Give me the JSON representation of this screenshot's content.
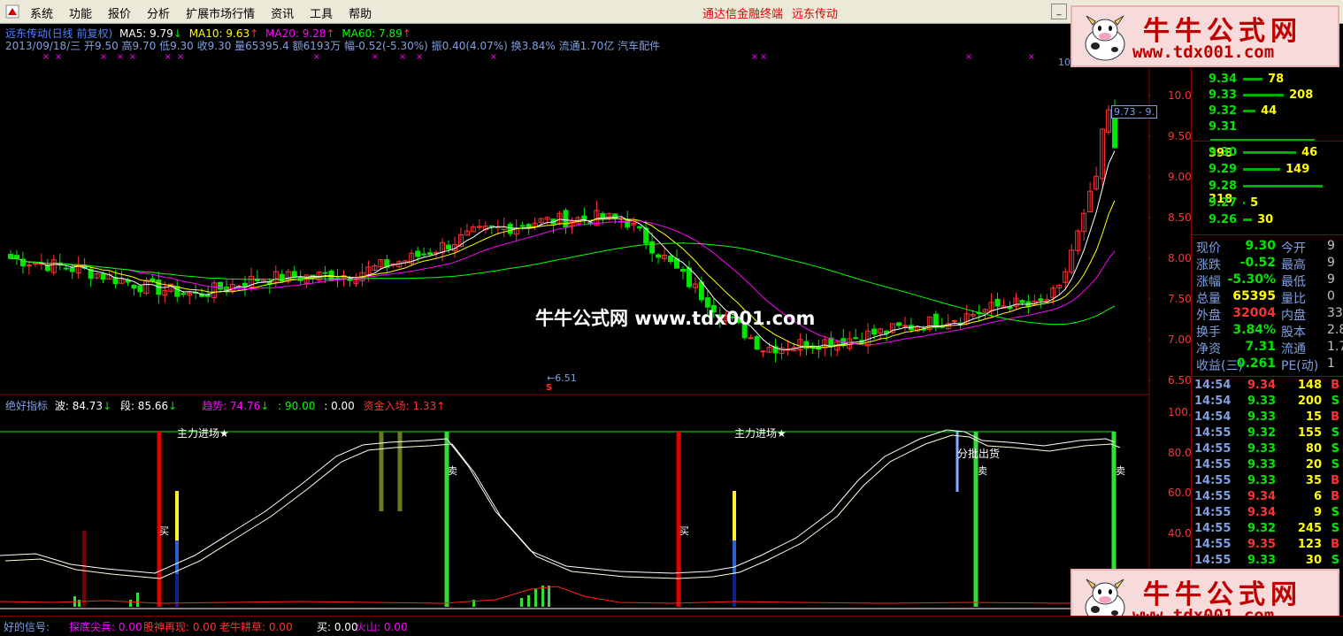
{
  "menu": {
    "items": [
      "系统",
      "功能",
      "报价",
      "分析",
      "扩展市场行情",
      "资讯",
      "工具",
      "帮助"
    ],
    "center_title": "通达信金融终端",
    "stock_title": "远东传动"
  },
  "header": {
    "chart_title": "远东传动(日线 前复权)",
    "ma5": "MA5: 9.79",
    "ma10": "MA10: 9.63",
    "ma20": "MA20: 9.28",
    "ma60": "MA60: 7.89",
    "info_line": "2013/09/18/三 开9.50 高9.70 低9.30 收9.30 量65395.4 额6193万 幅-0.52(-5.30%) 振0.40(4.07%) 换3.84% 流通1.70亿 汽车配件"
  },
  "indicator_header": {
    "name": "绝好指标",
    "wave": "波: 84.73",
    "segment": "段: 85.66",
    "trend": "趋势: 74.76",
    "v1": ": 90.00",
    "v2": ": 0.00",
    "fund": "资金入场: 1.33"
  },
  "annotations": {
    "low_label": "6.51",
    "high_label": "10",
    "price_tag": "9.73 - 9.",
    "s_marker": "S",
    "zhuli1": "主力进场★",
    "zhuli2": "主力进场★",
    "buy": "买",
    "sell": "卖",
    "fenpi": "分批出货"
  },
  "price_axis": [
    "10.00",
    "9.50",
    "9.00",
    "8.50",
    "8.00",
    "7.50",
    "7.00",
    "6.50"
  ],
  "ind_axis": [
    "100.0",
    "80.00",
    "60.00",
    "40.00"
  ],
  "order_book": {
    "asks": [
      {
        "price": "9.34",
        "vol": "78"
      },
      {
        "price": "9.33",
        "vol": "208"
      },
      {
        "price": "9.32",
        "vol": "44"
      },
      {
        "price": "9.31",
        "vol": "398"
      }
    ],
    "bids": [
      {
        "price": "9.30",
        "vol": "46"
      },
      {
        "price": "9.29",
        "vol": "149"
      },
      {
        "price": "9.28",
        "vol": "318"
      },
      {
        "price": "9.27",
        "vol": "5"
      },
      {
        "price": "9.26",
        "vol": "30"
      }
    ]
  },
  "quote": [
    {
      "l1": "现价",
      "v1": "9.30",
      "l2": "今开",
      "v2": "9"
    },
    {
      "l1": "涨跌",
      "v1": "-0.52",
      "l2": "最高",
      "v2": "9"
    },
    {
      "l1": "涨幅",
      "v1": "-5.30%",
      "l2": "最低",
      "v2": "9"
    },
    {
      "l1": "总量",
      "v1": "65395",
      "l2": "量比",
      "v2": "0"
    },
    {
      "l1": "外盘",
      "v1": "32004",
      "l2": "内盘",
      "v2": "33"
    },
    {
      "l1": "换手",
      "v1": "3.84%",
      "l2": "股本",
      "v2": "2.8"
    },
    {
      "l1": "净资",
      "v1": "7.31",
      "l2": "流通",
      "v2": "1.7"
    },
    {
      "l1": "收益(三)",
      "v1": "0.261",
      "l2": "PE(动)",
      "v2": "1"
    }
  ],
  "ticks": [
    {
      "t": "14:54",
      "p": "9.34",
      "v": "148",
      "s": "B"
    },
    {
      "t": "14:54",
      "p": "9.33",
      "v": "200",
      "s": "S"
    },
    {
      "t": "14:54",
      "p": "9.33",
      "v": "15",
      "s": "B"
    },
    {
      "t": "14:55",
      "p": "9.32",
      "v": "155",
      "s": "S"
    },
    {
      "t": "14:55",
      "p": "9.33",
      "v": "80",
      "s": "S"
    },
    {
      "t": "14:55",
      "p": "9.33",
      "v": "20",
      "s": "S"
    },
    {
      "t": "14:55",
      "p": "9.33",
      "v": "35",
      "s": "B"
    },
    {
      "t": "14:55",
      "p": "9.34",
      "v": "6",
      "s": "B"
    },
    {
      "t": "14:55",
      "p": "9.34",
      "v": "9",
      "s": "S"
    },
    {
      "t": "14:55",
      "p": "9.32",
      "v": "245",
      "s": "S"
    },
    {
      "t": "14:55",
      "p": "9.35",
      "v": "123",
      "s": "B"
    },
    {
      "t": "14:55",
      "p": "9.33",
      "v": "30",
      "s": "S"
    }
  ],
  "bottom": {
    "a": "好的信号:",
    "b": "探底尖兵: 0.00",
    "c": "股神再现: 0.00",
    "d": "老牛耕草: 0.00",
    "e": "买: 0.00",
    "f": "火山: 0.00"
  },
  "watermark": {
    "cn": "牛牛公式网",
    "url": "www.tdx001.com",
    "center": "牛牛公式网 www.tdx001.com"
  },
  "colors": {
    "up": "#ff3232",
    "down": "#00e600",
    "ma5": "#ffffff",
    "ma10": "#ffff00",
    "ma20": "#ff00ff",
    "ma60": "#00ff00"
  }
}
